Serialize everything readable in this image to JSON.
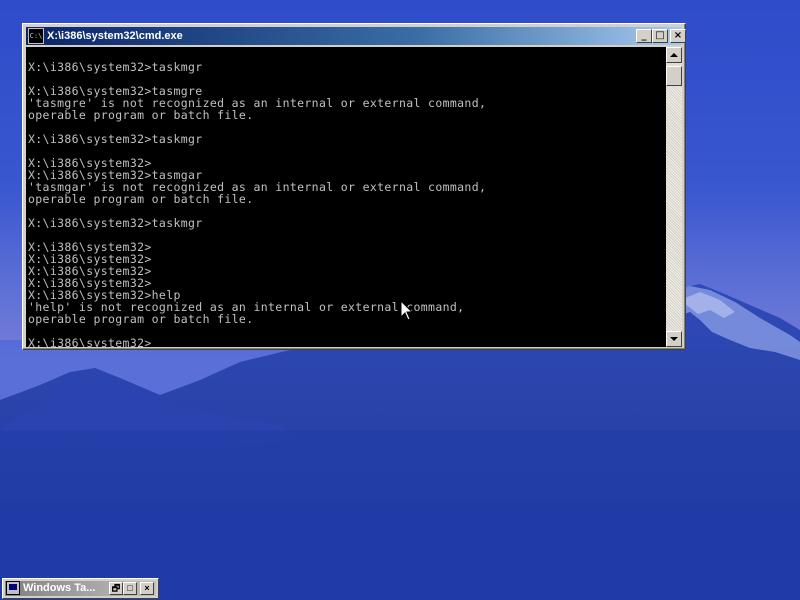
{
  "window": {
    "title": "X:\\i386\\system32\\cmd.exe",
    "icon_text": "C:\\",
    "buttons": {
      "minimize": "_",
      "maximize": "□",
      "close": "×"
    }
  },
  "console": {
    "lines": [
      "",
      "X:\\i386\\system32>taskmgr",
      "",
      "X:\\i386\\system32>tasmgre",
      "'tasmgre' is not recognized as an internal or external command,",
      "operable program or batch file.",
      "",
      "X:\\i386\\system32>taskmgr",
      "",
      "X:\\i386\\system32>",
      "X:\\i386\\system32>tasmgar",
      "'tasmgar' is not recognized as an internal or external command,",
      "operable program or batch file.",
      "",
      "X:\\i386\\system32>taskmgr",
      "",
      "X:\\i386\\system32>",
      "X:\\i386\\system32>",
      "X:\\i386\\system32>",
      "X:\\i386\\system32>",
      "X:\\i386\\system32>help",
      "'help' is not recognized as an internal or external command,",
      "operable program or batch file.",
      "",
      "X:\\i386\\system32>"
    ]
  },
  "scrollbar": {
    "up_icon": "up-arrow-icon",
    "down_icon": "down-arrow-icon"
  },
  "minimized_window": {
    "title": "Windows Ta...",
    "buttons": {
      "restore": "🗗",
      "maximize": "□",
      "close": "×"
    }
  },
  "colors": {
    "console_bg": "#000000",
    "console_fg": "#c0c0c0",
    "titlebar_active": "#0a246a",
    "titlebar_inactive": "#808080",
    "desktop_sky": "#3b55c9"
  }
}
